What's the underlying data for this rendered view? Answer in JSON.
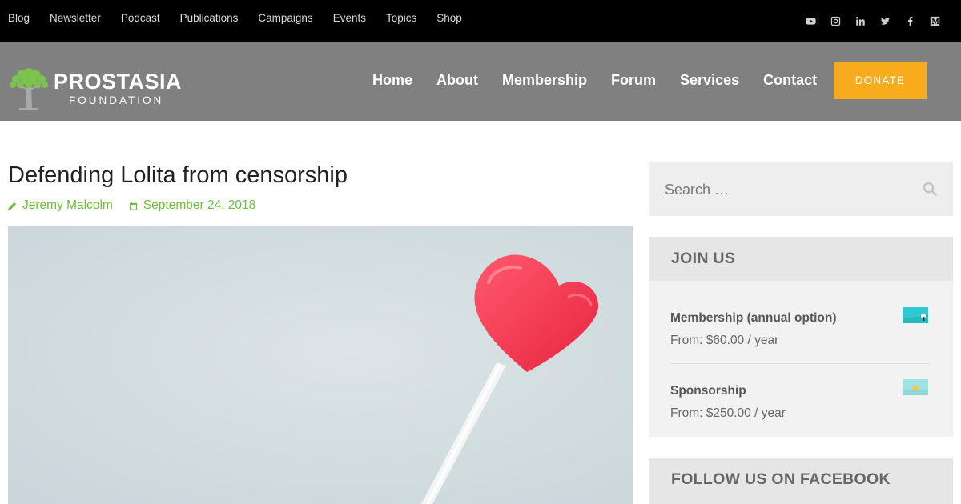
{
  "topbar": {
    "links": [
      "Blog",
      "Newsletter",
      "Podcast",
      "Publications",
      "Campaigns",
      "Events",
      "Topics",
      "Shop"
    ],
    "social_icons": [
      "youtube-icon",
      "instagram-icon",
      "linkedin-icon",
      "twitter-icon",
      "facebook-icon",
      "medium-icon"
    ]
  },
  "header": {
    "logo_name": "PROSTASIA",
    "logo_sub": "FOUNDATION",
    "nav": [
      "Home",
      "About",
      "Membership",
      "Forum",
      "Services",
      "Contact"
    ],
    "donate_label": "DONATE",
    "colors": {
      "topbar": "#000000",
      "header": "#808080",
      "donate": "#f6ac1c",
      "accent_green": "#6bbf3a"
    }
  },
  "article": {
    "title": "Defending Lolita from censorship",
    "author": "Jeremy Malcolm",
    "date": "September 24, 2018"
  },
  "sidebar": {
    "search_placeholder": "Search …",
    "join_title": "JOIN US",
    "products": [
      {
        "name": "Membership (annual option)",
        "price": "From: $60.00 / year"
      },
      {
        "name": "Sponsorship",
        "price": "From: $250.00 / year"
      }
    ],
    "facebook_title": "FOLLOW US ON FACEBOOK"
  }
}
